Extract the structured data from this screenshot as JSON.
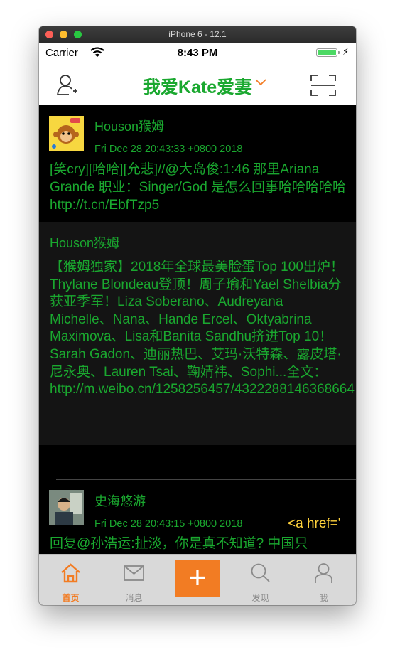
{
  "window": {
    "title": "iPhone 6 - 12.1"
  },
  "statusbar": {
    "carrier": "Carrier",
    "time": "8:43 PM"
  },
  "navbar": {
    "title": "我爱Kate爱妻"
  },
  "colors": {
    "accent_green": "#1aa82f",
    "accent_orange": "#f27c23",
    "link_yellow": "#ffd23c"
  },
  "feed": {
    "items": [
      {
        "author": "Houson猴姆",
        "time": "Fri Dec 28 20:43:33 +0800 2018",
        "text": "[笑cry][哈哈][允悲]//@大岛俊:1:46 那里Ariana Grande 职业：Singer/God 是怎么回事哈哈哈哈哈 http://t.cn/EbfTzp5",
        "retweet": {
          "author": "Houson猴姆",
          "text": "【猴姆独家】2018年全球最美脸蛋Top 100出炉！Thylane Blondeau登顶！周子瑜和Yael Shelbia分获亚季军！Liza Soberano、Audreyana Michelle、Nana、Hande Ercel、Oktyabrina Maximova、Lisa和Banita Sandhu挤进Top 10！Sarah Gadon、迪丽热巴、艾玛·沃特森、露皮塔·尼永奥、Lauren Tsai、鞠婧祎、Sophi...全文： http://m.weibo.cn/1258256457/4322288146368664"
        }
      },
      {
        "author": "史海悠游",
        "time": "Fri Dec 28 20:43:15 +0800 2018",
        "source": "<a href='",
        "text": "回复@孙浩运:扯淡，你是真不知道? 中国只"
      }
    ]
  },
  "tabbar": {
    "tabs": [
      {
        "label": "首页",
        "icon": "home-icon",
        "active": true
      },
      {
        "label": "消息",
        "icon": "envelope-icon",
        "active": false
      },
      {
        "label": "+",
        "icon": "plus-icon",
        "active": false
      },
      {
        "label": "发现",
        "icon": "search-icon",
        "active": false
      },
      {
        "label": "我",
        "icon": "person-icon",
        "active": false
      }
    ]
  }
}
